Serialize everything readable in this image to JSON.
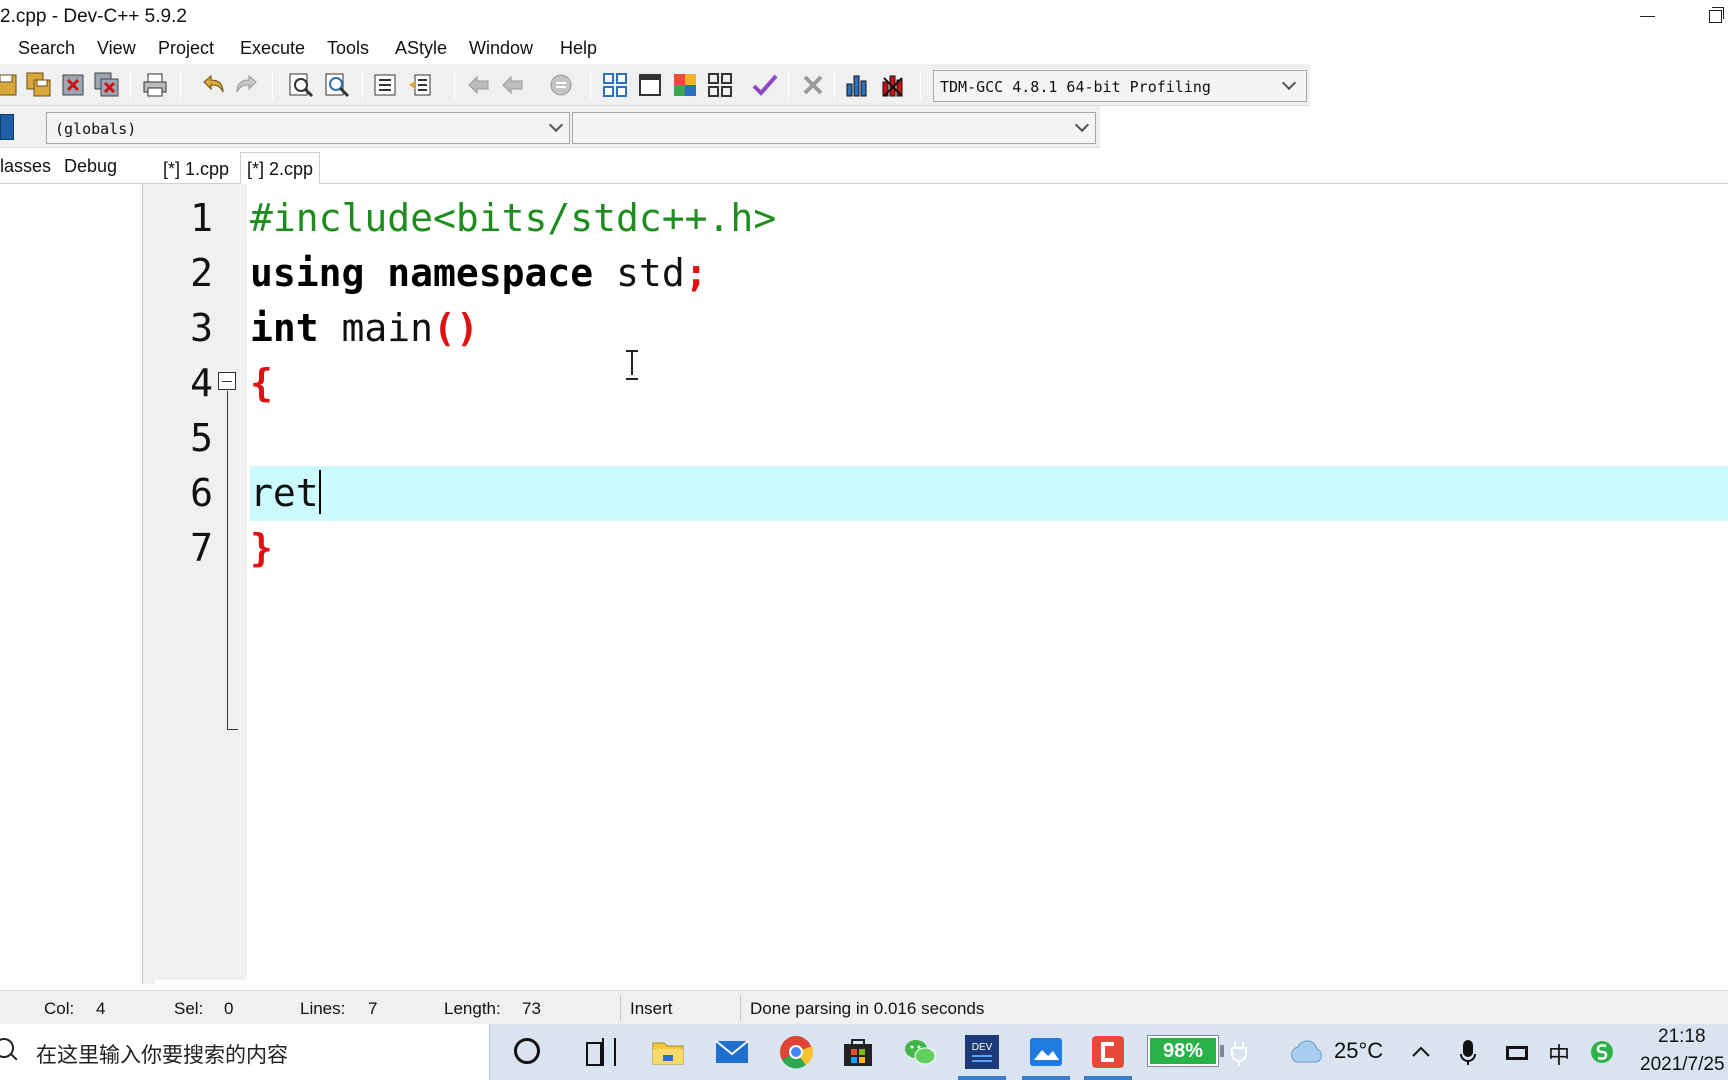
{
  "window": {
    "title": "2.cpp - Dev-C++ 5.9.2"
  },
  "menu": [
    "Search",
    "View",
    "Project",
    "Execute",
    "Tools",
    "AStyle",
    "Window",
    "Help"
  ],
  "toolbar": {
    "compiler": "TDM-GCC 4.8.1 64-bit Profiling",
    "scope": "(globals)",
    "member": ""
  },
  "side_tabs": [
    "lasses",
    "Debug"
  ],
  "editor_tabs": [
    "[*] 1.cpp",
    "[*] 2.cpp"
  ],
  "active_tab": "[*] 2.cpp",
  "code": {
    "line_numbers": [
      "1",
      "2",
      "3",
      "4",
      "5",
      "6",
      "7"
    ],
    "line1": {
      "pre": "#include<bits/stdc++.h>"
    },
    "line2": {
      "kw1": "using",
      "kw2": "namespace",
      "id": "std",
      "sym": ";"
    },
    "line3": {
      "kw": "int",
      "id": "main",
      "sym": "()"
    },
    "line4": {
      "sym": "{"
    },
    "line6": {
      "text": "ret"
    },
    "line7": {
      "sym": "}"
    },
    "current_line": 6
  },
  "status": {
    "col_label": "Col:",
    "col": "4",
    "sel_label": "Sel:",
    "sel": "0",
    "lines_label": "Lines:",
    "lines": "7",
    "length_label": "Length:",
    "length": "73",
    "mode": "Insert",
    "message": "Done parsing in 0.016 seconds"
  },
  "taskbar": {
    "search_placeholder": "在这里输入你要搜索的内容",
    "battery": "98%",
    "temperature": "25°C",
    "ime": "中",
    "time": "21:18",
    "date": "2021/7/25"
  },
  "colors": {
    "preprocessor": "#1f8c1f",
    "symbol": "#e01010",
    "current_line": "#ccfaff",
    "toolbar_bg": "#f0f0f0"
  }
}
